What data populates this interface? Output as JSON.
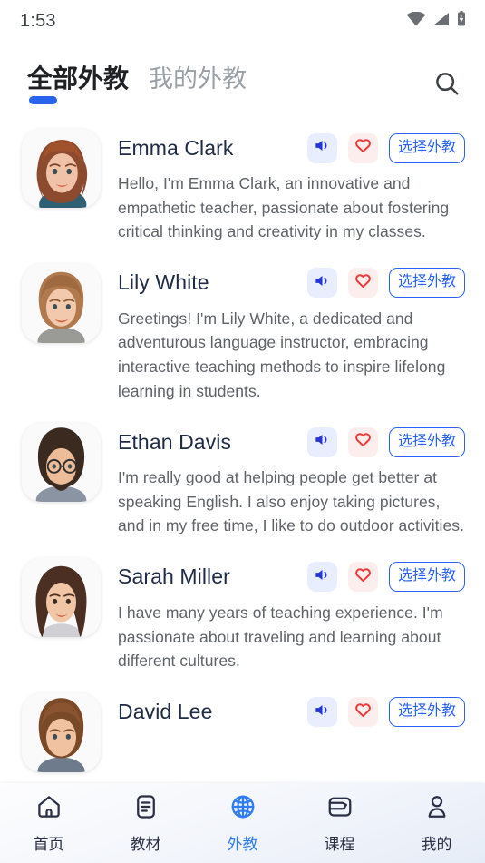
{
  "statusbar": {
    "time": "1:53",
    "icons": [
      "wifi-icon",
      "cellular-signal-icon",
      "battery-charging-icon"
    ]
  },
  "header": {
    "tabs": [
      {
        "label": "全部外教",
        "active": true
      },
      {
        "label": "我的外教",
        "active": false
      }
    ],
    "search_icon": "search-icon"
  },
  "colors": {
    "accent_blue": "#2864f0",
    "select_border": "#2a62f5",
    "heart_red": "#ea3b3b",
    "speaker_blue": "#2536d6",
    "tab_active_text": "#202124",
    "tab_inactive_text": "#9aa0a6",
    "bio_text": "#5f6368",
    "name_text": "#202b45",
    "nav_active": "#2f7cf6",
    "nav_inactive": "#2b2f45"
  },
  "teachers": [
    {
      "name": "Emma Clark",
      "bio": "Hello, I'm Emma Clark, an innovative and empathetic teacher, passionate about fostering critical thinking and creativity in my classes.",
      "speak_label": "speaker-icon",
      "fav_label": "heart-icon",
      "select_label": "选择外教"
    },
    {
      "name": "Lily White",
      "bio": "Greetings! I'm Lily White, a dedicated and adventurous language instructor, embracing interactive teaching methods to inspire lifelong learning in students.",
      "speak_label": "speaker-icon",
      "fav_label": "heart-icon",
      "select_label": "选择外教"
    },
    {
      "name": "Ethan Davis",
      "bio": "I'm really good at helping people get better at speaking English. I also enjoy taking pictures, and in my free time, I like to do outdoor activities.",
      "speak_label": "speaker-icon",
      "fav_label": "heart-icon",
      "select_label": "选择外教"
    },
    {
      "name": "Sarah Miller",
      "bio": "I have many years of teaching experience. I'm passionate about traveling and learning about different cultures.",
      "speak_label": "speaker-icon",
      "fav_label": "heart-icon",
      "select_label": "选择外教"
    },
    {
      "name": "David Lee",
      "bio": "",
      "speak_label": "speaker-icon",
      "fav_label": "heart-icon",
      "select_label": "选择外教"
    }
  ],
  "bottom_nav": [
    {
      "label": "首页",
      "icon": "home-icon",
      "active": false
    },
    {
      "label": "教材",
      "icon": "book-icon",
      "active": false
    },
    {
      "label": "外教",
      "icon": "globe-icon",
      "active": true
    },
    {
      "label": "课程",
      "icon": "wallet-icon",
      "active": false
    },
    {
      "label": "我的",
      "icon": "person-icon",
      "active": false
    }
  ]
}
